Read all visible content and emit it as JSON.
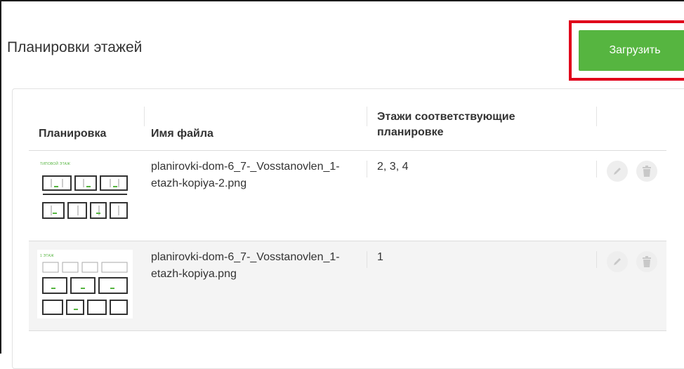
{
  "page": {
    "title": "Планировки этажей",
    "upload_button": "Загрузить",
    "accent_color": "#56b540",
    "highlight_color": "#e0001a"
  },
  "table": {
    "headers": {
      "layout": "Планировка",
      "filename": "Имя файла",
      "floors": "Этажи соответствующие планировке"
    },
    "rows": [
      {
        "thumb_label": "ТИПОВОЙ ЭТАЖ",
        "filename": "planirovki-dom-6_7-_Vosstanovlen_1-etazh-kopiya-2.png",
        "floors": "2, 3, 4",
        "edit_icon": "pencil-icon",
        "delete_icon": "trash-icon"
      },
      {
        "thumb_label": "1 ЭТАЖ",
        "filename": "planirovki-dom-6_7-_Vosstanovlen_1-etazh-kopiya.png",
        "floors": "1",
        "edit_icon": "pencil-icon",
        "delete_icon": "trash-icon"
      }
    ]
  }
}
